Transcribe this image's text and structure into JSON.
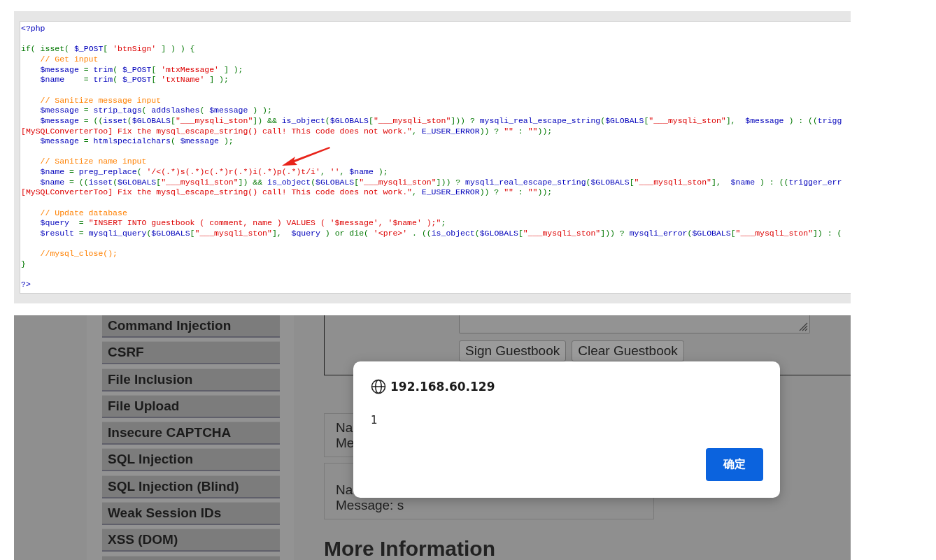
{
  "source_code": {
    "lines": [
      {
        "blank_before": false,
        "indented": false,
        "tokens": [
          {
            "kind": "variable",
            "t": "<?php"
          }
        ]
      },
      {
        "blank_before": true,
        "indented": false,
        "tokens": [
          {
            "kind": "keyword",
            "t": "if( isset( "
          },
          {
            "kind": "variable",
            "t": "$_POST"
          },
          {
            "kind": "keyword",
            "t": "[ "
          },
          {
            "kind": "string",
            "t": "'btnSign'"
          },
          {
            "kind": "keyword",
            "t": " ] ) ) {"
          }
        ]
      },
      {
        "blank_before": false,
        "indented": true,
        "tokens": [
          {
            "kind": "comment",
            "t": "// Get input"
          }
        ]
      },
      {
        "blank_before": false,
        "indented": true,
        "tokens": [
          {
            "kind": "variable",
            "t": "$message"
          },
          {
            "kind": "keyword",
            "t": " = "
          },
          {
            "kind": "variable",
            "t": "trim"
          },
          {
            "kind": "keyword",
            "t": "( "
          },
          {
            "kind": "variable",
            "t": "$_POST"
          },
          {
            "kind": "keyword",
            "t": "[ "
          },
          {
            "kind": "string",
            "t": "'mtxMessage'"
          },
          {
            "kind": "keyword",
            "t": " ] );"
          }
        ]
      },
      {
        "blank_before": false,
        "indented": true,
        "tokens": [
          {
            "kind": "variable",
            "t": "$name"
          },
          {
            "kind": "keyword",
            "t": "    = "
          },
          {
            "kind": "variable",
            "t": "trim"
          },
          {
            "kind": "keyword",
            "t": "( "
          },
          {
            "kind": "variable",
            "t": "$_POST"
          },
          {
            "kind": "keyword",
            "t": "[ "
          },
          {
            "kind": "string",
            "t": "'txtName'"
          },
          {
            "kind": "keyword",
            "t": " ] );"
          }
        ]
      },
      {
        "blank_before": true,
        "indented": true,
        "tokens": [
          {
            "kind": "comment",
            "t": "// Sanitize message input"
          }
        ]
      },
      {
        "blank_before": false,
        "indented": true,
        "tokens": [
          {
            "kind": "variable",
            "t": "$message"
          },
          {
            "kind": "keyword",
            "t": " = "
          },
          {
            "kind": "variable",
            "t": "strip_tags"
          },
          {
            "kind": "keyword",
            "t": "( "
          },
          {
            "kind": "variable",
            "t": "addslashes"
          },
          {
            "kind": "keyword",
            "t": "( "
          },
          {
            "kind": "variable",
            "t": "$message"
          },
          {
            "kind": "keyword",
            "t": " ) );"
          }
        ]
      },
      {
        "blank_before": false,
        "indented": true,
        "tokens": [
          {
            "kind": "variable",
            "t": "$message"
          },
          {
            "kind": "keyword",
            "t": " = (("
          },
          {
            "kind": "variable",
            "t": "isset"
          },
          {
            "kind": "keyword",
            "t": "("
          },
          {
            "kind": "variable",
            "t": "$GLOBALS"
          },
          {
            "kind": "keyword",
            "t": "["
          },
          {
            "kind": "string",
            "t": "\"___mysqli_ston\""
          },
          {
            "kind": "keyword",
            "t": "]) && "
          },
          {
            "kind": "variable",
            "t": "is_object"
          },
          {
            "kind": "keyword",
            "t": "("
          },
          {
            "kind": "variable",
            "t": "$GLOBALS"
          },
          {
            "kind": "keyword",
            "t": "["
          },
          {
            "kind": "string",
            "t": "\"___mysqli_ston\""
          },
          {
            "kind": "keyword",
            "t": "])) ? "
          },
          {
            "kind": "variable",
            "t": "mysqli_real_escape_string"
          },
          {
            "kind": "keyword",
            "t": "("
          },
          {
            "kind": "variable",
            "t": "$GLOBALS"
          },
          {
            "kind": "keyword",
            "t": "["
          },
          {
            "kind": "string",
            "t": "\"___mysqli_ston\""
          },
          {
            "kind": "keyword",
            "t": "],  "
          },
          {
            "kind": "variable",
            "t": "$message"
          },
          {
            "kind": "keyword",
            "t": " ) : (("
          },
          {
            "kind": "variable",
            "t": "trigg"
          }
        ]
      },
      {
        "blank_before": false,
        "indented": false,
        "tokens": [
          {
            "kind": "string",
            "t": "[MySQLConverterToo] Fix the mysql_escape_string() call! This code does not work.\""
          },
          {
            "kind": "keyword",
            "t": ", "
          },
          {
            "kind": "variable",
            "t": "E_USER_ERROR"
          },
          {
            "kind": "keyword",
            "t": ")) ? "
          },
          {
            "kind": "string",
            "t": "\"\""
          },
          {
            "kind": "keyword",
            "t": " : "
          },
          {
            "kind": "string",
            "t": "\"\""
          },
          {
            "kind": "keyword",
            "t": "));"
          }
        ]
      },
      {
        "blank_before": false,
        "indented": true,
        "tokens": [
          {
            "kind": "variable",
            "t": "$message"
          },
          {
            "kind": "keyword",
            "t": " = "
          },
          {
            "kind": "variable",
            "t": "htmlspecialchars"
          },
          {
            "kind": "keyword",
            "t": "( "
          },
          {
            "kind": "variable",
            "t": "$message"
          },
          {
            "kind": "keyword",
            "t": " );"
          }
        ]
      },
      {
        "blank_before": true,
        "indented": true,
        "tokens": [
          {
            "kind": "comment",
            "t": "// Sanitize name input"
          }
        ]
      },
      {
        "blank_before": false,
        "indented": true,
        "tokens": [
          {
            "kind": "variable",
            "t": "$name"
          },
          {
            "kind": "keyword",
            "t": " = "
          },
          {
            "kind": "variable",
            "t": "preg_replace"
          },
          {
            "kind": "keyword",
            "t": "( "
          },
          {
            "kind": "string",
            "t": "'/<(.*)s(.*)c(.*)r(.*)i(.*)p(.*)t/i'"
          },
          {
            "kind": "keyword",
            "t": ", "
          },
          {
            "kind": "string",
            "t": "''"
          },
          {
            "kind": "keyword",
            "t": ", "
          },
          {
            "kind": "variable",
            "t": "$name"
          },
          {
            "kind": "keyword",
            "t": " );"
          }
        ]
      },
      {
        "blank_before": false,
        "indented": true,
        "tokens": [
          {
            "kind": "variable",
            "t": "$name"
          },
          {
            "kind": "keyword",
            "t": " = (("
          },
          {
            "kind": "variable",
            "t": "isset"
          },
          {
            "kind": "keyword",
            "t": "("
          },
          {
            "kind": "variable",
            "t": "$GLOBALS"
          },
          {
            "kind": "keyword",
            "t": "["
          },
          {
            "kind": "string",
            "t": "\"___mysqli_ston\""
          },
          {
            "kind": "keyword",
            "t": "]) && "
          },
          {
            "kind": "variable",
            "t": "is_object"
          },
          {
            "kind": "keyword",
            "t": "("
          },
          {
            "kind": "variable",
            "t": "$GLOBALS"
          },
          {
            "kind": "keyword",
            "t": "["
          },
          {
            "kind": "string",
            "t": "\"___mysqli_ston\""
          },
          {
            "kind": "keyword",
            "t": "])) ? "
          },
          {
            "kind": "variable",
            "t": "mysqli_real_escape_string"
          },
          {
            "kind": "keyword",
            "t": "("
          },
          {
            "kind": "variable",
            "t": "$GLOBALS"
          },
          {
            "kind": "keyword",
            "t": "["
          },
          {
            "kind": "string",
            "t": "\"___mysqli_ston\""
          },
          {
            "kind": "keyword",
            "t": "],  "
          },
          {
            "kind": "variable",
            "t": "$name"
          },
          {
            "kind": "keyword",
            "t": " ) : (("
          },
          {
            "kind": "variable",
            "t": "trigger_err"
          }
        ]
      },
      {
        "blank_before": false,
        "indented": false,
        "tokens": [
          {
            "kind": "string",
            "t": "[MySQLConverterToo] Fix the mysql_escape_string() call! This code does not work.\""
          },
          {
            "kind": "keyword",
            "t": ", "
          },
          {
            "kind": "variable",
            "t": "E_USER_ERROR"
          },
          {
            "kind": "keyword",
            "t": ")) ? "
          },
          {
            "kind": "string",
            "t": "\"\""
          },
          {
            "kind": "keyword",
            "t": " : "
          },
          {
            "kind": "string",
            "t": "\"\""
          },
          {
            "kind": "keyword",
            "t": "));"
          }
        ]
      },
      {
        "blank_before": true,
        "indented": true,
        "tokens": [
          {
            "kind": "comment",
            "t": "// Update database"
          }
        ]
      },
      {
        "blank_before": false,
        "indented": true,
        "tokens": [
          {
            "kind": "variable",
            "t": "$query"
          },
          {
            "kind": "keyword",
            "t": "  = "
          },
          {
            "kind": "string",
            "t": "\"INSERT INTO guestbook ( comment, name ) VALUES ( '$message', '$name' );\""
          },
          {
            "kind": "keyword",
            "t": ";"
          }
        ]
      },
      {
        "blank_before": false,
        "indented": true,
        "tokens": [
          {
            "kind": "variable",
            "t": "$result"
          },
          {
            "kind": "keyword",
            "t": " = "
          },
          {
            "kind": "variable",
            "t": "mysqli_query"
          },
          {
            "kind": "keyword",
            "t": "("
          },
          {
            "kind": "variable",
            "t": "$GLOBALS"
          },
          {
            "kind": "keyword",
            "t": "["
          },
          {
            "kind": "string",
            "t": "\"___mysqli_ston\""
          },
          {
            "kind": "keyword",
            "t": "],  "
          },
          {
            "kind": "variable",
            "t": "$query"
          },
          {
            "kind": "keyword",
            "t": " ) or die( "
          },
          {
            "kind": "string",
            "t": "'<pre>'"
          },
          {
            "kind": "keyword",
            "t": " . (("
          },
          {
            "kind": "variable",
            "t": "is_object"
          },
          {
            "kind": "keyword",
            "t": "("
          },
          {
            "kind": "variable",
            "t": "$GLOBALS"
          },
          {
            "kind": "keyword",
            "t": "["
          },
          {
            "kind": "string",
            "t": "\"___mysqli_ston\""
          },
          {
            "kind": "keyword",
            "t": "])) ? "
          },
          {
            "kind": "variable",
            "t": "mysqli_error"
          },
          {
            "kind": "keyword",
            "t": "("
          },
          {
            "kind": "variable",
            "t": "$GLOBALS"
          },
          {
            "kind": "keyword",
            "t": "["
          },
          {
            "kind": "string",
            "t": "\"___mysqli_ston\""
          },
          {
            "kind": "keyword",
            "t": "]) : ("
          }
        ]
      },
      {
        "blank_before": true,
        "indented": true,
        "tokens": [
          {
            "kind": "comment",
            "t": "//mysql_close();"
          }
        ]
      },
      {
        "blank_before": false,
        "indented": false,
        "tokens": [
          {
            "kind": "keyword",
            "t": "}"
          }
        ]
      },
      {
        "blank_before": true,
        "indented": false,
        "tokens": [
          {
            "kind": "variable",
            "t": "?>"
          }
        ]
      }
    ]
  },
  "sidebar": {
    "items": [
      {
        "label": "Command Injection"
      },
      {
        "label": "CSRF"
      },
      {
        "label": "File Inclusion"
      },
      {
        "label": "File Upload"
      },
      {
        "label": "Insecure CAPTCHA"
      },
      {
        "label": "SQL Injection"
      },
      {
        "label": "SQL Injection (Blind)"
      },
      {
        "label": "Weak Session IDs"
      },
      {
        "label": "XSS (DOM)"
      }
    ]
  },
  "guestbook_form": {
    "buttons": [
      "Sign Guestbook",
      "Clear Guestbook"
    ]
  },
  "entries": [
    {
      "leading_blank_line": false,
      "lines": [
        "Na",
        "Me"
      ]
    },
    {
      "leading_blank_line": true,
      "lines": [
        "Na",
        "Message: s"
      ]
    }
  ],
  "heading": "More Information",
  "dialog": {
    "origin": "192.168.60.129",
    "message": "1",
    "button": "确定"
  }
}
